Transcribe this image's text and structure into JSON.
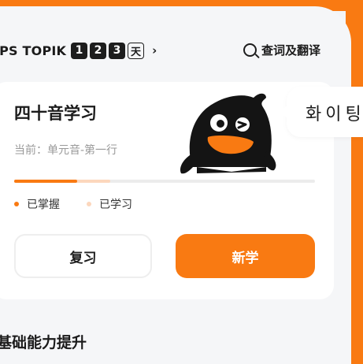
{
  "header": {
    "exam_label": "EPS TOPIK",
    "levels": [
      "1",
      "2",
      "3"
    ],
    "day_badge": "天",
    "chevron": "›",
    "search_label": "查词及翻译"
  },
  "study_card": {
    "title": "四十音学习",
    "current": "当前：单元音-第一行",
    "progress": {
      "mastered_fraction": 0.21,
      "learned_fraction": 0.32
    },
    "legend": {
      "mastered": "已掌握",
      "learned": "已学习"
    },
    "review_button": "复习",
    "new_button": "新学"
  },
  "speech_bubble": {
    "text": "화이팅"
  },
  "section_title": "基础能力提升",
  "colors": {
    "accent": "#f97a12",
    "learned": "#fcd7bd",
    "text": "#1d1d1d",
    "muted": "#9a9a9a"
  }
}
